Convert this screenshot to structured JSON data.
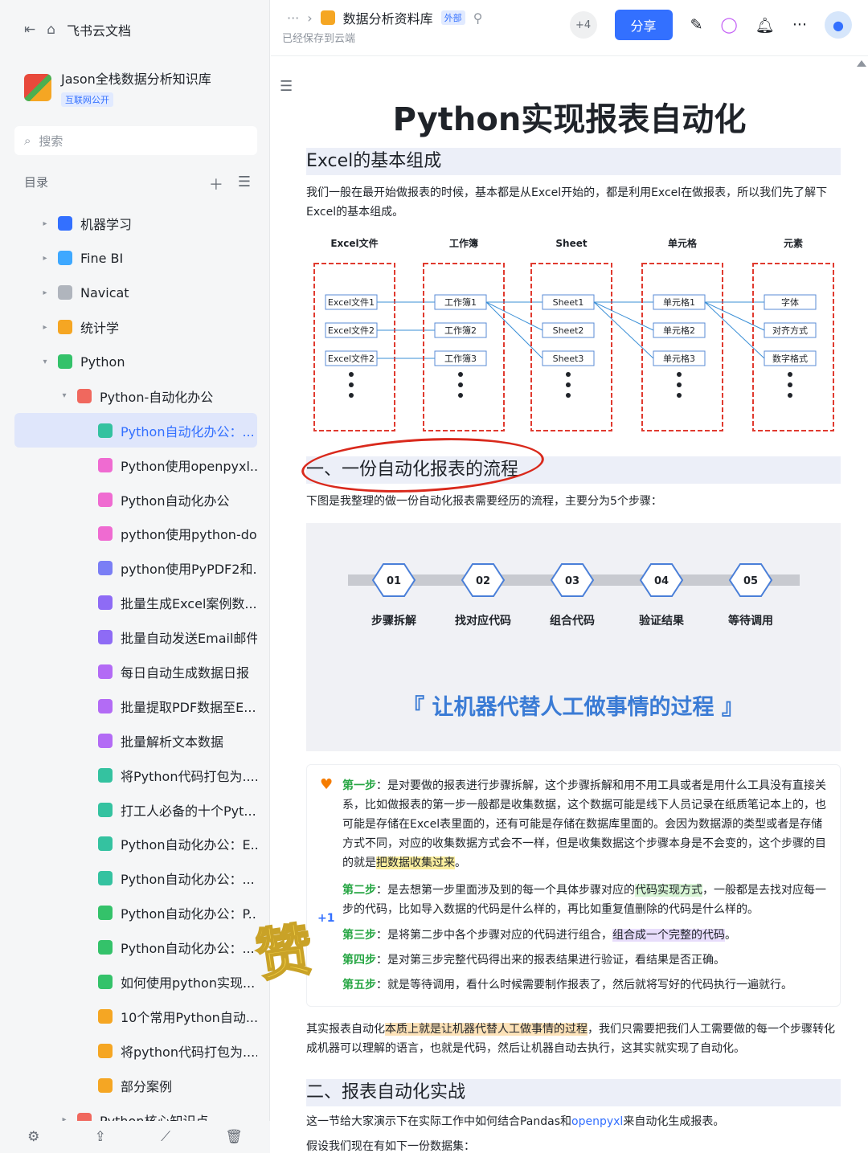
{
  "sidebar": {
    "app_name": "飞书云文档",
    "kb_name": "Jason全栈数据分析知识库",
    "kb_badge": "互联网公开",
    "search_placeholder": "搜索",
    "toc_label": "目录",
    "items": [
      {
        "label": "机器学习",
        "level": 1,
        "arrow": "▸",
        "color": "#3370ff"
      },
      {
        "label": "Fine BI",
        "level": 1,
        "arrow": "▸",
        "color": "#3ea8ff"
      },
      {
        "label": "Navicat",
        "level": 1,
        "arrow": "▸",
        "color": "#b0b5bd"
      },
      {
        "label": "统计学",
        "level": 1,
        "arrow": "▸",
        "color": "#f5a623"
      },
      {
        "label": "Python",
        "level": 1,
        "arrow": "▾",
        "color": "#34c26a"
      },
      {
        "label": "Python-自动化办公",
        "level": 2,
        "arrow": "▾",
        "color": "#f0685e"
      },
      {
        "label": "Python自动化办公：...",
        "level": 3,
        "arrow": "",
        "color": "#34c2a0",
        "active": true
      },
      {
        "label": "Python使用openpyxl...",
        "level": 3,
        "arrow": "",
        "color": "#ef6bd1"
      },
      {
        "label": "Python自动化办公",
        "level": 3,
        "arrow": "",
        "color": "#ef6bd1"
      },
      {
        "label": "python使用python-do...",
        "level": 3,
        "arrow": "",
        "color": "#ef6bd1"
      },
      {
        "label": "python使用PyPDF2和...",
        "level": 3,
        "arrow": "",
        "color": "#7a7ef5"
      },
      {
        "label": "批量生成Excel案例数...",
        "level": 3,
        "arrow": "",
        "color": "#8e6bf5"
      },
      {
        "label": "批量自动发送Email邮件",
        "level": 3,
        "arrow": "",
        "color": "#8e6bf5"
      },
      {
        "label": "每日自动生成数据日报",
        "level": 3,
        "arrow": "",
        "color": "#b36bf5"
      },
      {
        "label": "批量提取PDF数据至E...",
        "level": 3,
        "arrow": "",
        "color": "#b36bf5"
      },
      {
        "label": "批量解析文本数据",
        "level": 3,
        "arrow": "",
        "color": "#b36bf5"
      },
      {
        "label": "将Python代码打包为....",
        "level": 3,
        "arrow": "",
        "color": "#34c2a0"
      },
      {
        "label": "打工人必备的十个Pyt...",
        "level": 3,
        "arrow": "",
        "color": "#34c2a0"
      },
      {
        "label": "Python自动化办公：E...",
        "level": 3,
        "arrow": "",
        "color": "#34c2a0"
      },
      {
        "label": "Python自动化办公：...",
        "level": 3,
        "arrow": "",
        "color": "#34c2a0"
      },
      {
        "label": "Python自动化办公：P...",
        "level": 3,
        "arrow": "",
        "color": "#34c26a"
      },
      {
        "label": "Python自动化办公：...",
        "level": 3,
        "arrow": "",
        "color": "#34c26a"
      },
      {
        "label": "如何使用python实现...",
        "level": 3,
        "arrow": "",
        "color": "#34c26a"
      },
      {
        "label": "10个常用Python自动...",
        "level": 3,
        "arrow": "",
        "color": "#f5a623"
      },
      {
        "label": "将python代码打包为....",
        "level": 3,
        "arrow": "",
        "color": "#f5a623"
      },
      {
        "label": "部分案例",
        "level": 3,
        "arrow": "",
        "color": "#f5a623"
      },
      {
        "label": "Python核心知识点",
        "level": 2,
        "arrow": "▸",
        "color": "#f0685e"
      }
    ],
    "bottom_icons": [
      "settings-icon",
      "share-icon",
      "chart-icon",
      "trash-icon"
    ]
  },
  "header": {
    "breadcrumb_more": "···",
    "breadcrumb_sep": "›",
    "doc_name": "数据分析资料库",
    "external_tag": "外部",
    "saved_text": "已经保存到云端",
    "collaborators": "+4",
    "share_label": "分享"
  },
  "doc": {
    "title": "Python实现报表自动化",
    "section0_heading": "Excel的基本组成",
    "section0_para": "我们一般在最开始做报表的时候，基本都是从Excel开始的，都是利用Excel在做报表，所以我们先了解下Excel的基本组成。",
    "diagram": {
      "columns": [
        {
          "header": "Excel文件",
          "cells": [
            "Excel文件1",
            "Excel文件2",
            "Excel文件2"
          ]
        },
        {
          "header": "工作簿",
          "cells": [
            "工作簿1",
            "工作簿2",
            "工作簿3"
          ]
        },
        {
          "header": "Sheet",
          "cells": [
            "Sheet1",
            "Sheet2",
            "Sheet3"
          ]
        },
        {
          "header": "单元格",
          "cells": [
            "单元格1",
            "单元格2",
            "单元格3"
          ]
        },
        {
          "header": "元素",
          "cells": [
            "字体",
            "对齐方式",
            "数字格式"
          ]
        }
      ]
    },
    "section1_heading": "一、一份自动化报表的流程",
    "section1_para": "下图是我整理的做一份自动化报表需要经历的流程，主要分为5个步骤：",
    "flow": {
      "steps": [
        {
          "num": "01",
          "label": "步骤拆解"
        },
        {
          "num": "02",
          "label": "找对应代码"
        },
        {
          "num": "03",
          "label": "组合代码"
        },
        {
          "num": "04",
          "label": "验证结果"
        },
        {
          "num": "05",
          "label": "等待调用"
        }
      ],
      "slogan": "『  让机器代替人工做事情的过程  』"
    },
    "callout": {
      "step1_label": "第一步",
      "step1_text": "：是对要做的报表进行步骤拆解，这个步骤拆解和用不用工具或者是用什么工具没有直接关系，比如做报表的第一步一般都是收集数据，这个数据可能是线下人员记录在纸质笔记本上的，也可能是存储在Excel表里面的，还有可能是存储在数据库里面的。会因为数据源的类型或者是存储方式不同，对应的收集数据方式会不一样，但是收集数据这个步骤本身是不会变的，这个步骤的目的就是",
      "step1_hl": "把数据收集过来",
      "step1_end": "。",
      "step2_label": "第二步",
      "step2_text": "：是去想第一步里面涉及到的每一个具体步骤对应的",
      "step2_hl": "代码实现方式",
      "step2_end": "，一般都是去找对应每一步的代码，比如导入数据的代码是什么样的，再比如重复值删除的代码是什么样的。",
      "step3_label": "第三步",
      "step3_text": "：是将第二步中各个步骤对应的代码进行组合，",
      "step3_hl": "组合成一个完整的代码",
      "step3_end": "。",
      "step4_label": "第四步",
      "step4_text": "：是对第三步完整代码得出来的报表结果进行验证，看结果是否正确。",
      "step5_label": "第五步",
      "step5_text": "：就是等待调用，看什么时候需要制作报表了，然后就将写好的代码执行一遍就行。"
    },
    "summary_pre": "其实报表自动化",
    "summary_hl": "本质上就是让机器代替人工做事情的过程",
    "summary_post": "，我们只需要把我们人工需要做的每一个步骤转化成机器可以理解的语言，也就是代码，然后让机器自动去执行，这其实就实现了自动化。",
    "section2_heading": "二、报表自动化实战",
    "section2_para_pre": "这一节给大家演示下在实际工作中如何结合Pandas和",
    "section2_link": "openpyxl",
    "section2_para_post": "来自动化生成报表。",
    "section2_para2": "假设我们现在有如下一份数据集：",
    "sticker": "赞",
    "sticker_sup": "+1"
  },
  "colors": {
    "accent": "#3370ff",
    "annotation_red": "#d9291c",
    "step_green": "#27a644"
  }
}
